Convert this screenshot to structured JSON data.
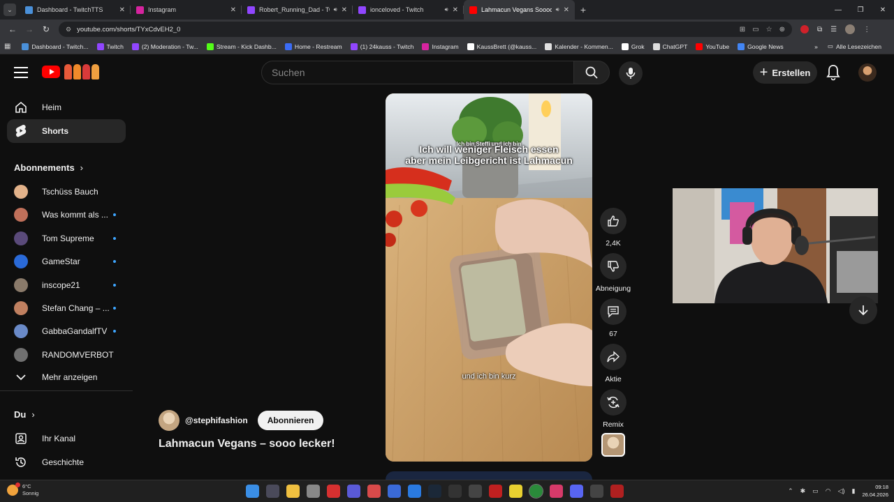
{
  "browser": {
    "tabs": [
      {
        "title": "Dashboard - TwitchTTS",
        "color": "#4a90d9",
        "speaker": false
      },
      {
        "title": "Instagram",
        "color": "#d6249f",
        "speaker": false
      },
      {
        "title": "Robert_Running_Dad - Twit",
        "color": "#9146ff",
        "speaker": true
      },
      {
        "title": "ionceloved - Twitch",
        "color": "#9146ff",
        "speaker": true
      },
      {
        "title": "Lahmacun Vegans Soooo d",
        "color": "#ff0000",
        "speaker": true,
        "active": true
      }
    ],
    "url": "youtube.com/shorts/TYxCdvEH2_0",
    "bookmarks": [
      {
        "label": "Dashboard - Twitch...",
        "color": "#4a90d9"
      },
      {
        "label": "Twitch",
        "color": "#9146ff"
      },
      {
        "label": "(2) Moderation - Tw...",
        "color": "#9146ff"
      },
      {
        "label": "Stream - Kick Dashb...",
        "color": "#53fc18"
      },
      {
        "label": "Home - Restream",
        "color": "#3b6cf6"
      },
      {
        "label": "(1) 24kauss - Twitch",
        "color": "#9146ff"
      },
      {
        "label": "Instagram",
        "color": "#d6249f"
      },
      {
        "label": "KaussBrett (@kauss...",
        "color": "#ffffff"
      },
      {
        "label": "Kalender - Kommen...",
        "color": "#e0e0e0"
      },
      {
        "label": "Grok",
        "color": "#ffffff"
      },
      {
        "label": "ChatGPT",
        "color": "#dddddd"
      },
      {
        "label": "YouTube",
        "color": "#ff0000"
      },
      {
        "label": "Google News",
        "color": "#4285f4"
      }
    ],
    "all_bookmarks": "Alle Lesezeichen"
  },
  "youtube": {
    "search_placeholder": "Suchen",
    "create_label": "Erstellen",
    "nav": [
      {
        "label": "Heim",
        "icon": "home-icon"
      },
      {
        "label": "Shorts",
        "icon": "shorts-icon"
      }
    ],
    "subscriptions_heading": "Abonnements",
    "subscriptions": [
      {
        "name": "Tschüss Bauch",
        "color": "#e2b28a",
        "new": false
      },
      {
        "name": "Was kommt als ...",
        "color": "#c0705a",
        "new": true
      },
      {
        "name": "Tom Supreme",
        "color": "#5a4a7a",
        "new": true
      },
      {
        "name": "GameStar",
        "color": "#2a6ad8",
        "new": true
      },
      {
        "name": "inscope21",
        "color": "#8a7a6a",
        "new": true
      },
      {
        "name": "Stefan Chang – ...",
        "color": "#c08060",
        "new": true
      },
      {
        "name": "GabbaGandalfTV",
        "color": "#6a8ac8",
        "new": true
      },
      {
        "name": "RANDOMVERBOT",
        "color": "#707070",
        "new": false
      }
    ],
    "show_more": "Mehr anzeigen",
    "you_heading": "Du",
    "you_items": [
      {
        "label": "Ihr Kanal",
        "icon": "channel-icon"
      },
      {
        "label": "Geschichte",
        "icon": "history-icon"
      }
    ],
    "short": {
      "caption_small": "Ich bin Steffi und ich bin",
      "caption_line1": "Ich will weniger Fleisch essen",
      "caption_line2": "aber mein Leibgericht ist Lahmacun",
      "caption_bottom": "und ich bin kurz",
      "channel": "@stephifashion",
      "subscribe": "Abonnieren",
      "title": "Lahmacun Vegans – sooo lecker!"
    },
    "actions": {
      "likes": "2,4K",
      "dislike": "Abneigung",
      "comments": "67",
      "share": "Aktie",
      "remix": "Remix"
    }
  },
  "taskbar": {
    "weather_temp": "6°C",
    "weather_desc": "Sonnig",
    "time": "09:18",
    "date": "26.04.2026"
  }
}
